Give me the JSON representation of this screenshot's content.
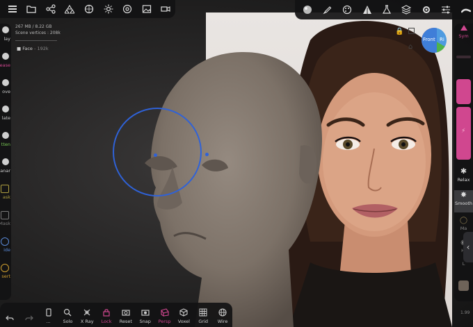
{
  "stats": {
    "memory": "267 MB / 8.22 GB",
    "scene_vertices": "Scene vertices : 208k"
  },
  "scene": {
    "object_name": "Face",
    "object_vertices": "192k"
  },
  "gizmo": {
    "front_label": "Front",
    "side_label": "Ri"
  },
  "version_label": "1.99",
  "left_tools": [
    {
      "label": "lay",
      "icon": "clay-brush-icon",
      "color": "#cfcfcf"
    },
    {
      "label": "ease",
      "icon": "crease-brush-icon",
      "color": "#d0478f"
    },
    {
      "label": "ove",
      "icon": "move-brush-icon",
      "color": "#cfcfcf"
    },
    {
      "label": "late",
      "icon": "flatten-brush-icon",
      "color": "#cfcfcf"
    },
    {
      "label": "tten",
      "icon": "flatten-brush-icon",
      "color": "#7ccc55"
    },
    {
      "label": "anar",
      "icon": "planar-brush-icon",
      "color": "#cfcfcf"
    },
    {
      "label": "ask",
      "icon": "mask-icon",
      "color": "#b0a040"
    },
    {
      "label": "Mask",
      "icon": "mask-icon",
      "color": "#7a7a7a"
    },
    {
      "label": "ide",
      "icon": "hide-icon",
      "color": "#5a8ad8"
    },
    {
      "label": "sert",
      "icon": "insert-icon",
      "color": "#d0a030"
    }
  ],
  "right_tools": {
    "sym_label": "Sym",
    "relax_label": "Relax",
    "smooth_label": "Smooth",
    "mask_label": "Ma",
    "hide_label": "Hi",
    "last_label": "L"
  },
  "top_left_tools": [
    "menu-icon",
    "folder-icon",
    "share-icon",
    "scene-icon",
    "material-icon",
    "light-icon",
    "settings-icon",
    "image-icon",
    "video-icon"
  ],
  "top_right_tools": [
    "brush-sphere-icon",
    "pen-icon",
    "palette-icon",
    "topology-icon",
    "flask-icon",
    "layers-icon",
    "gear-icon",
    "sliders-icon",
    "stroke-icon"
  ],
  "bottom_tools": [
    {
      "label": "",
      "icon": "undo-icon"
    },
    {
      "label": "",
      "icon": "redo-icon"
    },
    {
      "label": "...",
      "icon": "phone-icon"
    },
    {
      "label": "Solo",
      "icon": "search-icon"
    },
    {
      "label": "X Ray",
      "icon": "xray-icon"
    },
    {
      "label": "Lock",
      "icon": "lock-icon",
      "active": true
    },
    {
      "label": "Reset",
      "icon": "reset-camera-icon"
    },
    {
      "label": "Snap",
      "icon": "snap-camera-icon"
    },
    {
      "label": "Persp",
      "icon": "perspective-icon",
      "active": true
    },
    {
      "label": "Voxel",
      "icon": "voxel-icon"
    },
    {
      "label": "Grid",
      "icon": "grid-icon"
    },
    {
      "label": "Wire",
      "icon": "wire-icon"
    }
  ],
  "colors": {
    "accent": "#d0478f",
    "brush_ring": "#2f62d8",
    "clay": "#7c7167"
  }
}
